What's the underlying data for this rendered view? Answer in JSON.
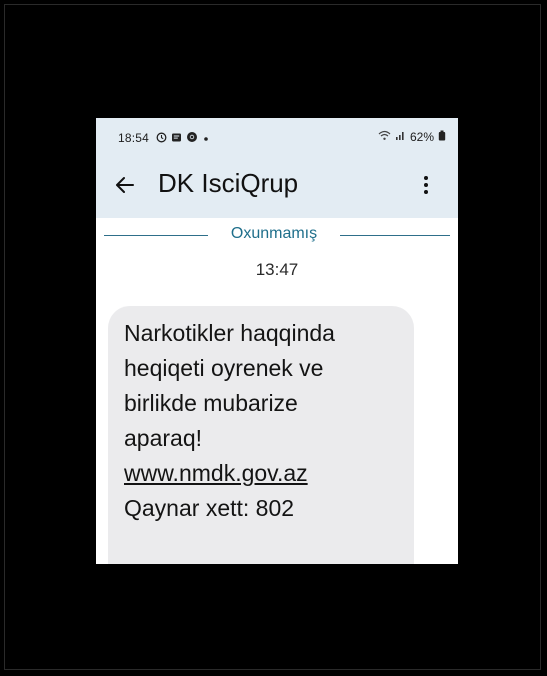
{
  "status_bar": {
    "time": "18:54",
    "battery": "62%"
  },
  "toolbar": {
    "title": "DK IsciQrup"
  },
  "conversation": {
    "divider_label": "Oxunmamış",
    "timestamp": "13:47",
    "message_lines": [
      "Narkotikler haqqinda",
      "heqiqeti oyrenek ve",
      "birlikde mubarize",
      "aparaq!"
    ],
    "message_link": "www.nmdk.gov.az",
    "message_hotline": "Qaynar xett: 802"
  },
  "icons": {
    "back": "arrow-left-icon",
    "menu": "more-vert-icon",
    "wifi": "wifi-icon",
    "signal": "signal-icon",
    "battery": "battery-icon"
  },
  "colors": {
    "appbar_background": "#e3ecf3",
    "divider_accent": "#1f6f8b",
    "bubble_background": "#ebebed"
  }
}
